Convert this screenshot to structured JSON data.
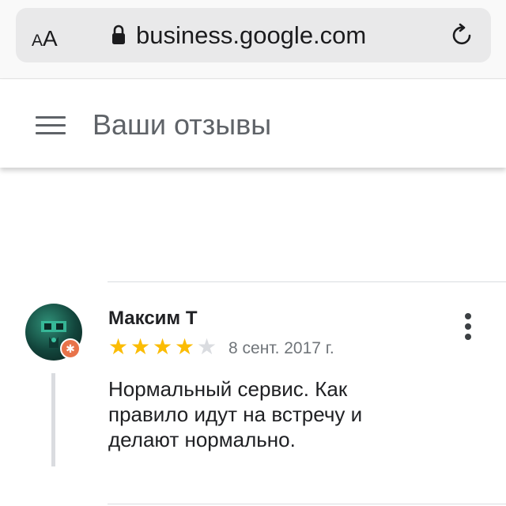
{
  "browser": {
    "text_size_label_small": "A",
    "text_size_label_large": "A",
    "url": "business.google.com"
  },
  "appbar": {
    "title": "Ваши отзывы"
  },
  "review": {
    "author": "Максим Т",
    "rating": 4,
    "max_rating": 5,
    "date": "8 сент. 2017 г.",
    "text": "Нормальный сервис. Как правило идут на встречу и делают нормально."
  },
  "colors": {
    "star_on": "#fbbc04",
    "star_off": "#dadce0",
    "badge": "#e8734a"
  }
}
